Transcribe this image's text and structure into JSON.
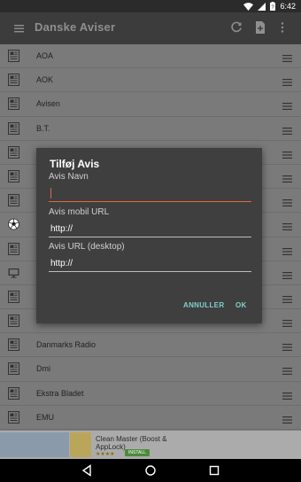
{
  "status_bar": {
    "time": "6:42",
    "icons": [
      "wifi-icon",
      "signal-icon",
      "battery-icon"
    ]
  },
  "app_bar": {
    "title": "Danske Aviser",
    "actions": [
      "refresh-icon",
      "add-document-icon",
      "overflow-menu-icon"
    ]
  },
  "list": {
    "items": [
      {
        "icon": "newspaper-icon",
        "label": "AOA"
      },
      {
        "icon": "newspaper-icon",
        "label": "AOK"
      },
      {
        "icon": "newspaper-icon",
        "label": "Avisen"
      },
      {
        "icon": "newspaper-icon",
        "label": "B.T."
      },
      {
        "icon": "newspaper-icon",
        "label": ""
      },
      {
        "icon": "newspaper-icon",
        "label": ""
      },
      {
        "icon": "newspaper-icon",
        "label": ""
      },
      {
        "icon": "soccer-ball-icon",
        "label": ""
      },
      {
        "icon": "newspaper-icon",
        "label": ""
      },
      {
        "icon": "monitor-icon",
        "label": ""
      },
      {
        "icon": "newspaper-icon",
        "label": ""
      },
      {
        "icon": "newspaper-icon",
        "label": ""
      },
      {
        "icon": "newspaper-icon",
        "label": "Danmarks Radio"
      },
      {
        "icon": "newspaper-icon",
        "label": "Dmi"
      },
      {
        "icon": "newspaper-icon",
        "label": "Ekstra Bladet"
      },
      {
        "icon": "newspaper-icon",
        "label": "EMU"
      }
    ]
  },
  "dialog": {
    "title": "Tilføj Avis",
    "name_label": "Avis Navn",
    "name_value": "",
    "mobile_label": "Avis mobil URL",
    "mobile_value": "http://",
    "desktop_label": "Avis URL (desktop)",
    "desktop_value": "http://",
    "cancel_label": "ANNULLER",
    "ok_label": "OK"
  },
  "ad": {
    "text": "Clean Master (Boost & AppLock)",
    "rating": "★★★★",
    "install_label": "INSTALL"
  },
  "colors": {
    "accent": "#e0693f",
    "button_text": "#7ed0cc",
    "app_bar": "#3c3c3c",
    "dialog_bg": "#3f3f3f"
  }
}
